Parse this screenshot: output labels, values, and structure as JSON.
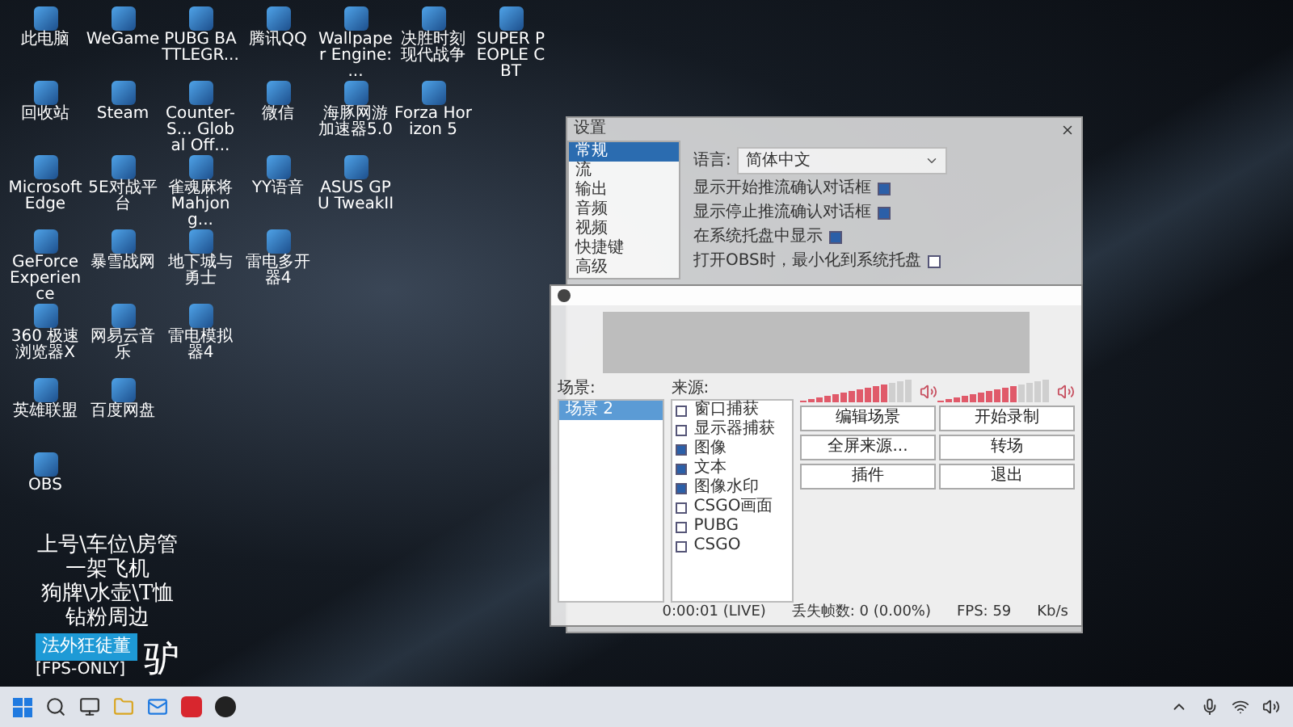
{
  "desktop": {
    "columns": [
      {
        "icons": [
          {
            "label": "此电脑"
          },
          {
            "label": "回收站"
          },
          {
            "label": "Microsoft Edge"
          },
          {
            "label": "GeForce Experience"
          },
          {
            "label": "360 极速浏览器X"
          },
          {
            "label": "英雄联盟"
          },
          {
            "label": "OBS"
          }
        ]
      },
      {
        "icons": [
          {
            "label": "WeGame"
          },
          {
            "label": "Steam"
          },
          {
            "label": "5E对战平台"
          },
          {
            "label": "暴雪战网"
          },
          {
            "label": "网易云音乐"
          },
          {
            "label": "百度网盘"
          }
        ]
      },
      {
        "icons": [
          {
            "label": "PUBG BATTLEGR..."
          },
          {
            "label": "Counter-S... Global Off..."
          },
          {
            "label": "雀魂麻将 Mahjong..."
          },
          {
            "label": "地下城与勇士"
          },
          {
            "label": "雷电模拟器4"
          }
        ]
      },
      {
        "icons": [
          {
            "label": "腾讯QQ"
          },
          {
            "label": "微信"
          },
          {
            "label": "YY语音"
          },
          {
            "label": "雷电多开器4"
          }
        ]
      },
      {
        "icons": [
          {
            "label": "Wallpaper Engine: ..."
          },
          {
            "label": "海豚网游加速器5.0"
          },
          {
            "label": "ASUS GPU TweakII"
          }
        ]
      },
      {
        "icons": [
          {
            "label": "决胜时刻现代战争"
          },
          {
            "label": "Forza Horizon 5"
          }
        ]
      },
      {
        "icons": [
          {
            "label": "SUPER PEOPLE CBT"
          }
        ]
      }
    ]
  },
  "promo": {
    "lines": [
      "上号\\车位\\房管",
      "一架飞机",
      "狗牌\\水壶\\T恤",
      "钻粉周边"
    ],
    "badge": "法外狂徒董",
    "tag": "[FPS-ONLY]",
    "big_glyph": "驴"
  },
  "settings_dialog": {
    "title": "设置",
    "sidebar": [
      {
        "label": "常规",
        "selected": true
      },
      {
        "label": "流",
        "selected": false
      },
      {
        "label": "输出",
        "selected": false
      },
      {
        "label": "音频",
        "selected": false
      },
      {
        "label": "视频",
        "selected": false
      },
      {
        "label": "快捷键",
        "selected": false
      },
      {
        "label": "高级",
        "selected": false
      }
    ],
    "language_label": "语言:",
    "language_value": "简体中文",
    "options": [
      {
        "label": "显示开始推流确认对话框",
        "checked": true
      },
      {
        "label": "显示停止推流确认对话框",
        "checked": true
      },
      {
        "label": "在系统托盘中显示",
        "checked": true
      },
      {
        "label": "打开OBS时，最小化到系统托盘",
        "checked": false
      }
    ]
  },
  "obs_main": {
    "scenes_label": "场景:",
    "scenes": [
      {
        "label": "场景 2",
        "selected": true
      }
    ],
    "sources_label": "来源:",
    "sources": [
      {
        "label": "窗口捕获",
        "checked": false
      },
      {
        "label": "显示器捕获",
        "checked": false
      },
      {
        "label": "图像",
        "checked": true
      },
      {
        "label": "文本",
        "checked": true
      },
      {
        "label": "图像水印",
        "checked": true
      },
      {
        "label": "CSGO画面",
        "checked": false
      },
      {
        "label": "PUBG",
        "checked": false
      },
      {
        "label": "CSGO",
        "checked": false
      }
    ],
    "meters": [
      {
        "level": 0.75
      },
      {
        "level": 0.7
      }
    ],
    "buttons": [
      "编辑场景",
      "开始录制",
      "全屏来源...",
      "转场",
      "插件",
      "退出"
    ],
    "status": [
      "0:00:01 (LIVE)",
      "丢失帧数: 0 (0.00%)",
      "FPS: 59",
      "Kb/s"
    ]
  }
}
